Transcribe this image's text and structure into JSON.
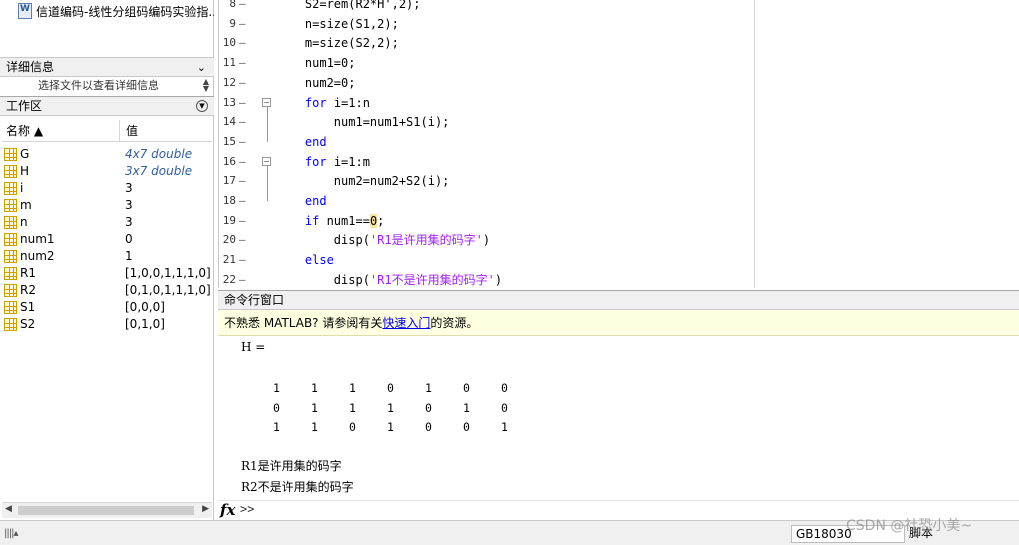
{
  "file_browser": {
    "file_name": "信道编码-线性分组码编码实验指..."
  },
  "details_panel": {
    "title": "详细信息",
    "hint": "选择文件以查看详细信息"
  },
  "workspace": {
    "title": "工作区",
    "columns": {
      "name": "名称 ▲",
      "value": "值"
    },
    "variables": [
      {
        "name": "G",
        "value": "4x7 double",
        "meta": true
      },
      {
        "name": "H",
        "value": "3x7 double",
        "meta": true
      },
      {
        "name": "i",
        "value": "3"
      },
      {
        "name": "m",
        "value": "3"
      },
      {
        "name": "n",
        "value": "3"
      },
      {
        "name": "num1",
        "value": "0"
      },
      {
        "name": "num2",
        "value": "1"
      },
      {
        "name": "R1",
        "value": "[1,0,0,1,1,1,0]"
      },
      {
        "name": "R2",
        "value": "[0,1,0,1,1,1,0]"
      },
      {
        "name": "S1",
        "value": "[0,0,0]"
      },
      {
        "name": "S2",
        "value": "[0,1,0]"
      }
    ]
  },
  "editor": {
    "lines": [
      {
        "num": "8",
        "parts": [
          {
            "t": "    S2=rem(R2*H',2);"
          }
        ]
      },
      {
        "num": "9",
        "parts": [
          {
            "t": "    n=size(S1,2);"
          }
        ]
      },
      {
        "num": "10",
        "parts": [
          {
            "t": "    m=size(S2,2);"
          }
        ]
      },
      {
        "num": "11",
        "parts": [
          {
            "t": "    num1=0;"
          }
        ]
      },
      {
        "num": "12",
        "parts": [
          {
            "t": "    num2=0;"
          }
        ]
      },
      {
        "num": "13",
        "fold": "start",
        "parts": [
          {
            "t": "    "
          },
          {
            "t": "for",
            "c": "kw"
          },
          {
            "t": " i=1:n"
          }
        ]
      },
      {
        "num": "14",
        "parts": [
          {
            "t": "        num1=num1+S1(i);"
          }
        ]
      },
      {
        "num": "15",
        "fold": "end",
        "parts": [
          {
            "t": "    "
          },
          {
            "t": "end",
            "c": "kw"
          }
        ]
      },
      {
        "num": "16",
        "fold": "start",
        "parts": [
          {
            "t": "    "
          },
          {
            "t": "for",
            "c": "kw"
          },
          {
            "t": " i=1:m"
          }
        ]
      },
      {
        "num": "17",
        "parts": [
          {
            "t": "        num2=num2+S2(i);"
          }
        ]
      },
      {
        "num": "18",
        "fold": "end",
        "parts": [
          {
            "t": "    "
          },
          {
            "t": "end",
            "c": "kw"
          }
        ]
      },
      {
        "num": "19",
        "parts": [
          {
            "t": "    "
          },
          {
            "t": "if",
            "c": "kw"
          },
          {
            "t": " num1=="
          },
          {
            "t": "0",
            "c": "hl"
          },
          {
            "t": ";"
          }
        ]
      },
      {
        "num": "20",
        "parts": [
          {
            "t": "        disp("
          },
          {
            "t": "'R1是许用集的码字'",
            "c": "str"
          },
          {
            "t": ")"
          }
        ]
      },
      {
        "num": "21",
        "parts": [
          {
            "t": "    "
          },
          {
            "t": "else",
            "c": "kw"
          }
        ]
      },
      {
        "num": "22",
        "parts": [
          {
            "t": "        disp("
          },
          {
            "t": "'R1不是许用集的码字'",
            "c": "str"
          },
          {
            "t": ")"
          }
        ]
      }
    ]
  },
  "command_window": {
    "title": "命令行窗口",
    "banner": {
      "prefix": "不熟悉 MATLAB? 请参阅有关",
      "link": "快速入门",
      "suffix": "的资源。"
    },
    "output_var": "H =",
    "matrix": [
      [
        "1",
        "1",
        "1",
        "0",
        "1",
        "0",
        "0"
      ],
      [
        "0",
        "1",
        "1",
        "1",
        "0",
        "1",
        "0"
      ],
      [
        "1",
        "1",
        "0",
        "1",
        "0",
        "0",
        "1"
      ]
    ],
    "result_lines": [
      "R1是许用集的码字",
      "R2不是许用集的码字"
    ],
    "fx_label": "fx",
    "prompt": ">>"
  },
  "statusbar": {
    "encoding": "GB18030",
    "file_type": "脚本",
    "watermark": "CSDN @社恐小美~"
  }
}
